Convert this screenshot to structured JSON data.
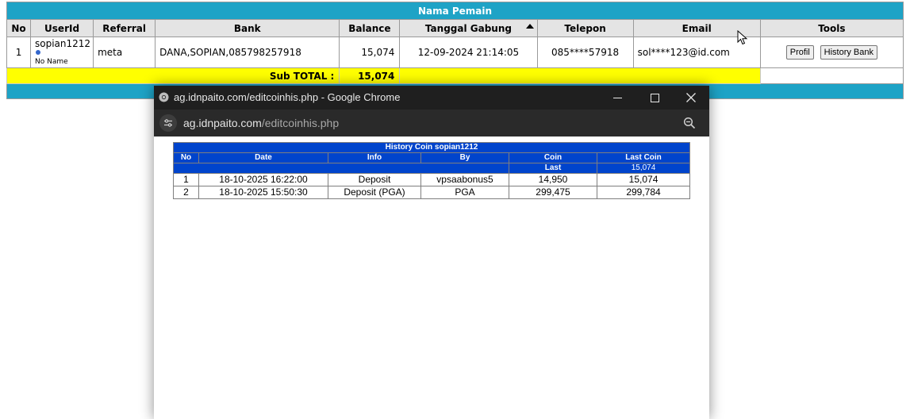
{
  "main": {
    "title": "Nama Pemain",
    "headers": [
      "No",
      "UserId",
      "Referral",
      "Bank",
      "Balance",
      "Tanggal Gabung",
      "Telepon",
      "Email",
      "Tools"
    ],
    "row": {
      "no": "1",
      "userid": "sopian1212",
      "userid_sub": "No Name",
      "referral": "meta",
      "bank": "DANA,SOPIAN,085798257918",
      "balance": "15,074",
      "tanggal_gabung": "12-09-2024 21:14:05",
      "telepon": "085****57918",
      "email": "sol****123@id.com",
      "btn_profil": "Profil",
      "btn_history_bank": "History Bank"
    },
    "subtotal_label": "Sub TOTAL :",
    "subtotal_value": "15,074"
  },
  "popup": {
    "window_title": "ag.idnpaito.com/editcoinhis.php - Google Chrome",
    "url_domain": "ag.idnpaito.com",
    "url_path": "/editcoinhis.php"
  },
  "history": {
    "title": "History Coin sopian1212",
    "headers": [
      "No",
      "Date",
      "Info",
      "By",
      "Coin",
      "Last Coin"
    ],
    "sub_coin": "Last",
    "sub_last_coin": "15,074",
    "rows": [
      {
        "no": "1",
        "date": "18-10-2025 16:22:00",
        "info": "Deposit",
        "by": "vpsaabonus5",
        "coin": "14,950",
        "last_coin": "15,074"
      },
      {
        "no": "2",
        "date": "18-10-2025 15:50:30",
        "info": "Deposit (PGA)",
        "by": "PGA",
        "coin": "299,475",
        "last_coin": "299,784"
      }
    ]
  },
  "colors": {
    "header_teal": "#1ea3c6",
    "subtotal_yellow": "#ffff00",
    "history_blue": "#0044cc",
    "chrome_dark": "#1f1f1f"
  }
}
